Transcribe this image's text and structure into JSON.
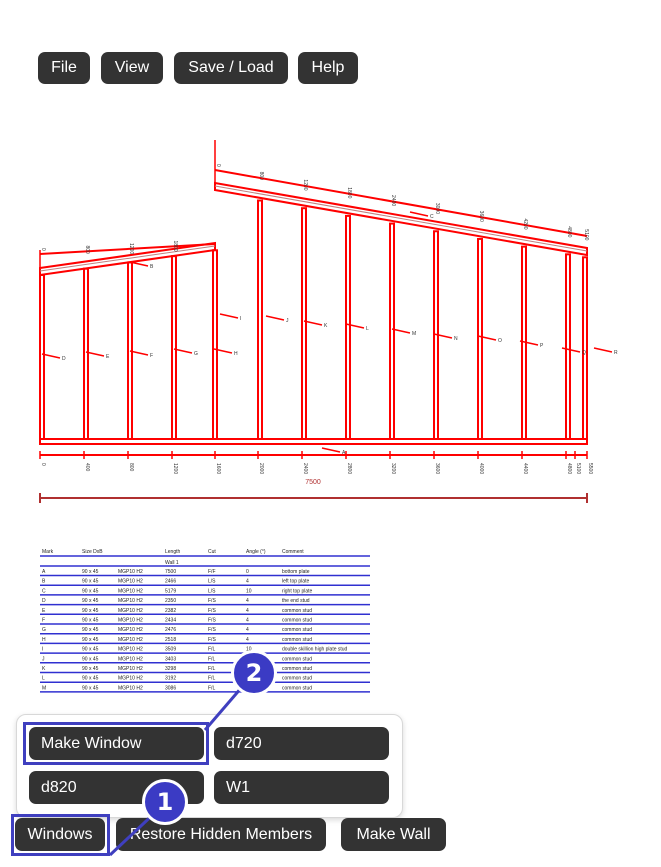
{
  "toolbar": {
    "file": "File",
    "view": "View",
    "save_load": "Save / Load",
    "help": "Help"
  },
  "drawing": {
    "total_length": "7500",
    "top_ticks": [
      "0",
      "800",
      "1200",
      "1800",
      "0",
      "800",
      "1200",
      "1800",
      "2400",
      "3000",
      "3600",
      "4200",
      "4800",
      "5100"
    ],
    "bottom_ticks": [
      "0",
      "400",
      "800",
      "1200",
      "1600",
      "2000",
      "2400",
      "2800",
      "3200",
      "3600",
      "4000",
      "4400",
      "4800",
      "5100",
      "5500"
    ],
    "member_marks": [
      "A",
      "B",
      "C",
      "D",
      "E",
      "F",
      "G",
      "H",
      "I",
      "J",
      "K",
      "L",
      "M",
      "N",
      "O",
      "P",
      "Q",
      "R"
    ]
  },
  "parts_table": {
    "headers": [
      "Mark",
      "Size DxB",
      "",
      "Length",
      "Cut",
      "Angle (°)",
      "Comment"
    ],
    "group": "Wall 1",
    "rows": [
      [
        "A",
        "90 x 45",
        "MGP10 H2",
        "7500",
        "F/F",
        "0",
        "bottom plate"
      ],
      [
        "B",
        "90 x 45",
        "MGP10 H2",
        "2466",
        "L/S",
        "4",
        "left top plate"
      ],
      [
        "C",
        "90 x 45",
        "MGP10 H2",
        "5179",
        "L/S",
        "10",
        "right top plate"
      ],
      [
        "D",
        "90 x 45",
        "MGP10 H2",
        "2350",
        "F/S",
        "4",
        "the end stud"
      ],
      [
        "E",
        "90 x 45",
        "MGP10 H2",
        "2382",
        "F/S",
        "4",
        "common stud"
      ],
      [
        "F",
        "90 x 45",
        "MGP10 H2",
        "2434",
        "F/S",
        "4",
        "common stud"
      ],
      [
        "G",
        "90 x 45",
        "MGP10 H2",
        "2476",
        "F/S",
        "4",
        "common stud"
      ],
      [
        "H",
        "90 x 45",
        "MGP10 H2",
        "2518",
        "F/S",
        "4",
        "common stud"
      ],
      [
        "I",
        "90 x 45",
        "MGP10 H2",
        "3509",
        "F/L",
        "10",
        "double skillion high plate stud"
      ],
      [
        "J",
        "90 x 45",
        "MGP10 H2",
        "3403",
        "F/L",
        "10",
        "common stud"
      ],
      [
        "K",
        "90 x 45",
        "MGP10 H2",
        "3298",
        "F/L",
        "10",
        "common stud"
      ],
      [
        "L",
        "90 x 45",
        "MGP10 H2",
        "3192",
        "F/L",
        "10",
        "common stud"
      ],
      [
        "M",
        "90 x 45",
        "MGP10 H2",
        "3086",
        "F/L",
        "-10",
        "common stud"
      ]
    ]
  },
  "popup": {
    "make_window": "Make Window",
    "d720": "d720",
    "d820": "d820",
    "w1": "W1"
  },
  "bottom_bar": {
    "windows": "Windows",
    "restore_hidden": "Restore Hidden Members",
    "make_wall": "Make Wall"
  },
  "annotations": {
    "badge1": "1",
    "badge2": "2"
  },
  "colors": {
    "member": "#ff0000",
    "dim": "#b03030",
    "table_rule": "#3030d0",
    "button": "#333333",
    "highlight": "#3f3fbf"
  }
}
